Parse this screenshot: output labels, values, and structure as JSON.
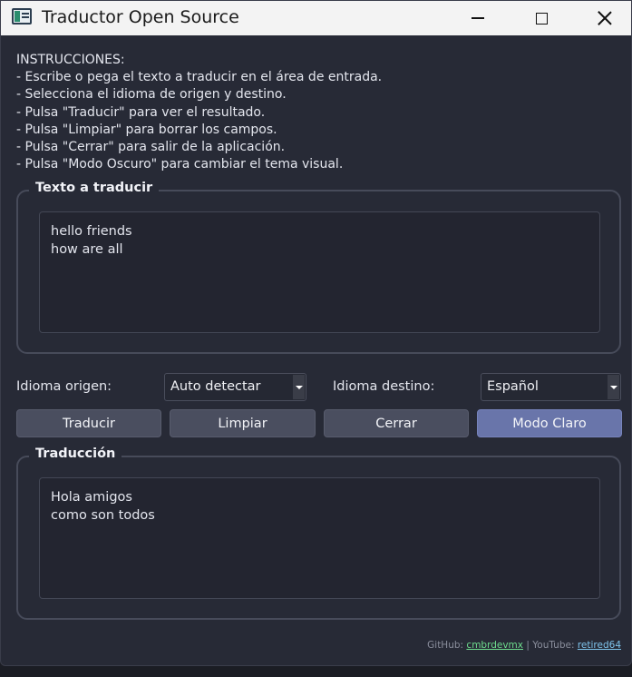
{
  "window": {
    "title": "Traductor Open Source"
  },
  "instructions": [
    "INSTRUCCIONES:",
    "- Escribe o pega el texto a traducir en el área de entrada.",
    "- Selecciona el idioma de origen y destino.",
    "- Pulsa \"Traducir\" para ver el resultado.",
    "- Pulsa \"Limpiar\" para borrar los campos.",
    "- Pulsa \"Cerrar\" para salir de la aplicación.",
    "- Pulsa \"Modo Oscuro\" para cambiar el tema visual."
  ],
  "input_group": {
    "title": "Texto a traducir",
    "lines": [
      "hello friends",
      "how are all"
    ]
  },
  "languages": {
    "source_label": "Idioma origen:",
    "source_value": "Auto detectar",
    "target_label": "Idioma destino:",
    "target_value": "Español"
  },
  "buttons": {
    "translate": "Traducir",
    "clear": "Limpiar",
    "close": "Cerrar",
    "theme": "Modo Claro"
  },
  "output_group": {
    "title": "Traducción",
    "lines": [
      "Hola amigos",
      "como son todos"
    ]
  },
  "footer": {
    "github_label": "GitHub:",
    "github_user": "cmbrdevmx",
    "separator": "|",
    "youtube_label": "YouTube:",
    "youtube_user": "retired64"
  },
  "colors": {
    "background": "#272a36",
    "button": "#4a4e5f",
    "accent_button": "#6975aa",
    "github_link": "#6edc8e",
    "youtube_link": "#7fc4ec"
  }
}
